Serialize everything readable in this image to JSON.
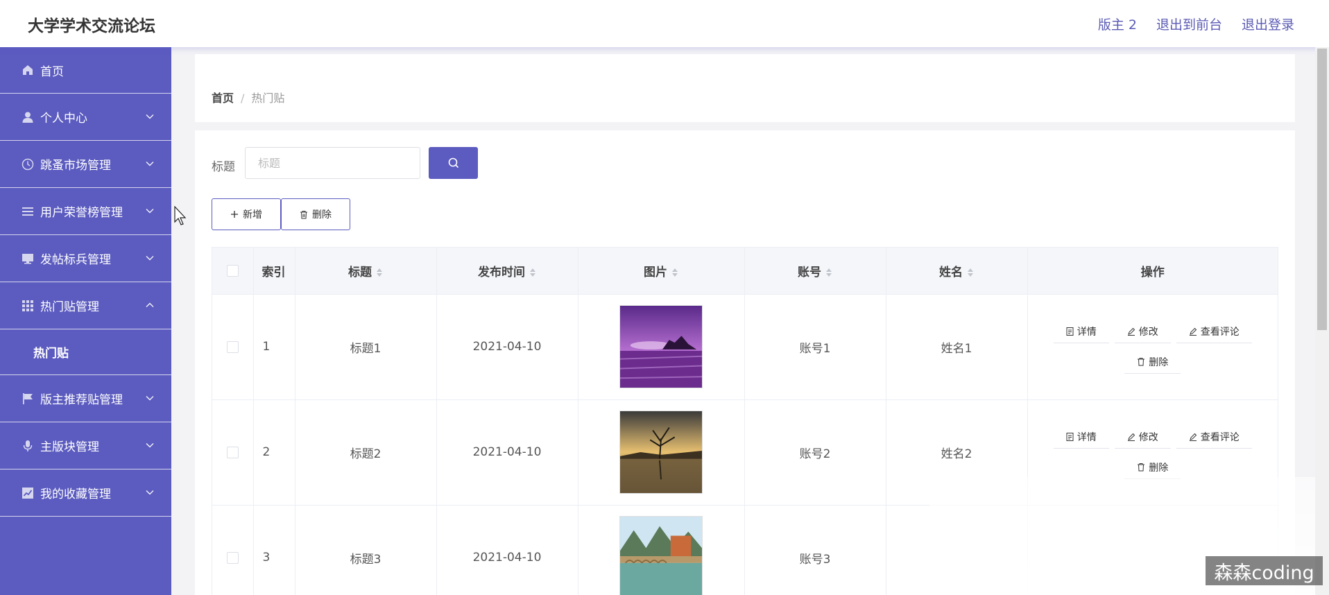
{
  "header": {
    "title": "大学学术交流论坛",
    "links": [
      "版主 2",
      "退出到前台",
      "退出登录"
    ]
  },
  "sidebar": {
    "items": [
      {
        "label": "首页",
        "icon": "home-icon"
      },
      {
        "label": "个人中心",
        "icon": "user-icon"
      },
      {
        "label": "跳蚤市场管理",
        "icon": "clock-icon"
      },
      {
        "label": "用户荣誉榜管理",
        "icon": "list-icon"
      },
      {
        "label": "发帖标兵管理",
        "icon": "monitor-icon"
      },
      {
        "label": "热门贴管理",
        "icon": "grid-icon"
      },
      {
        "label": "版主推荐贴管理",
        "icon": "flag-icon"
      },
      {
        "label": "主版块管理",
        "icon": "microphone-icon"
      },
      {
        "label": "我的收藏管理",
        "icon": "chart-icon"
      }
    ],
    "submenu": "热门贴"
  },
  "breadcrumb": {
    "home": "首页",
    "separator": "/",
    "current": "热门贴"
  },
  "search": {
    "label": "标题",
    "placeholder": "标题"
  },
  "toolbar": {
    "add_label": "新增",
    "delete_label": "删除"
  },
  "table": {
    "headers": [
      "索引",
      "标题",
      "发布时间",
      "图片",
      "账号",
      "姓名",
      "操作"
    ],
    "rows": [
      {
        "index": "1",
        "title": "标题1",
        "date": "2021-04-10",
        "account": "账号1",
        "name": "姓名1"
      },
      {
        "index": "2",
        "title": "标题2",
        "date": "2021-04-10",
        "account": "账号2",
        "name": "姓名2"
      },
      {
        "index": "3",
        "title": "标题3",
        "date": "2021-04-10",
        "account": "账号3",
        "name": ""
      }
    ],
    "actions": [
      "详情",
      "修改",
      "查看评论",
      "删除"
    ]
  },
  "watermark": "森森coding",
  "colors": {
    "accent": "#5b5bc0",
    "header_link": "#5a5ab5"
  }
}
